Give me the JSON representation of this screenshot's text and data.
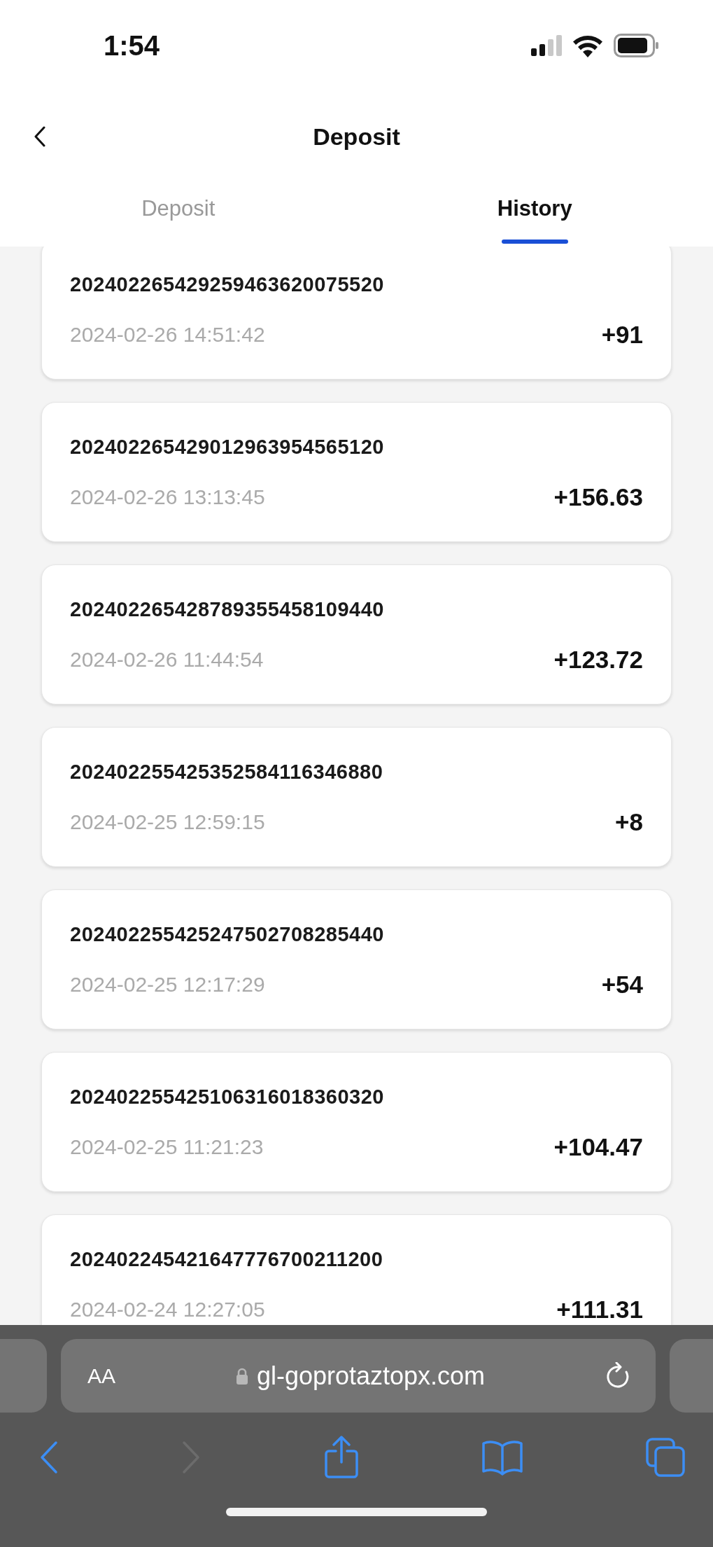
{
  "status_bar": {
    "time": "1:54"
  },
  "header": {
    "title": "Deposit"
  },
  "tabs": [
    {
      "label": "Deposit",
      "selected": false
    },
    {
      "label": "History",
      "selected": true
    }
  ],
  "transactions": [
    {
      "id": "202402265429259463620075520",
      "date": "2024-02-26 14:51:42",
      "amount": "+91"
    },
    {
      "id": "202402265429012963954565120",
      "date": "2024-02-26 13:13:45",
      "amount": "+156.63"
    },
    {
      "id": "202402265428789355458109440",
      "date": "2024-02-26 11:44:54",
      "amount": "+123.72"
    },
    {
      "id": "202402255425352584116346880",
      "date": "2024-02-25 12:59:15",
      "amount": "+8"
    },
    {
      "id": "202402255425247502708285440",
      "date": "2024-02-25 12:17:29",
      "amount": "+54"
    },
    {
      "id": "202402255425106316018360320",
      "date": "2024-02-25 11:21:23",
      "amount": "+104.47"
    },
    {
      "id": "202402245421647776700211200",
      "date": "2024-02-24 12:27:05",
      "amount": "+111.31"
    }
  ],
  "browser": {
    "text_size": "AA",
    "url": "gl-goprotaztopx.com"
  }
}
